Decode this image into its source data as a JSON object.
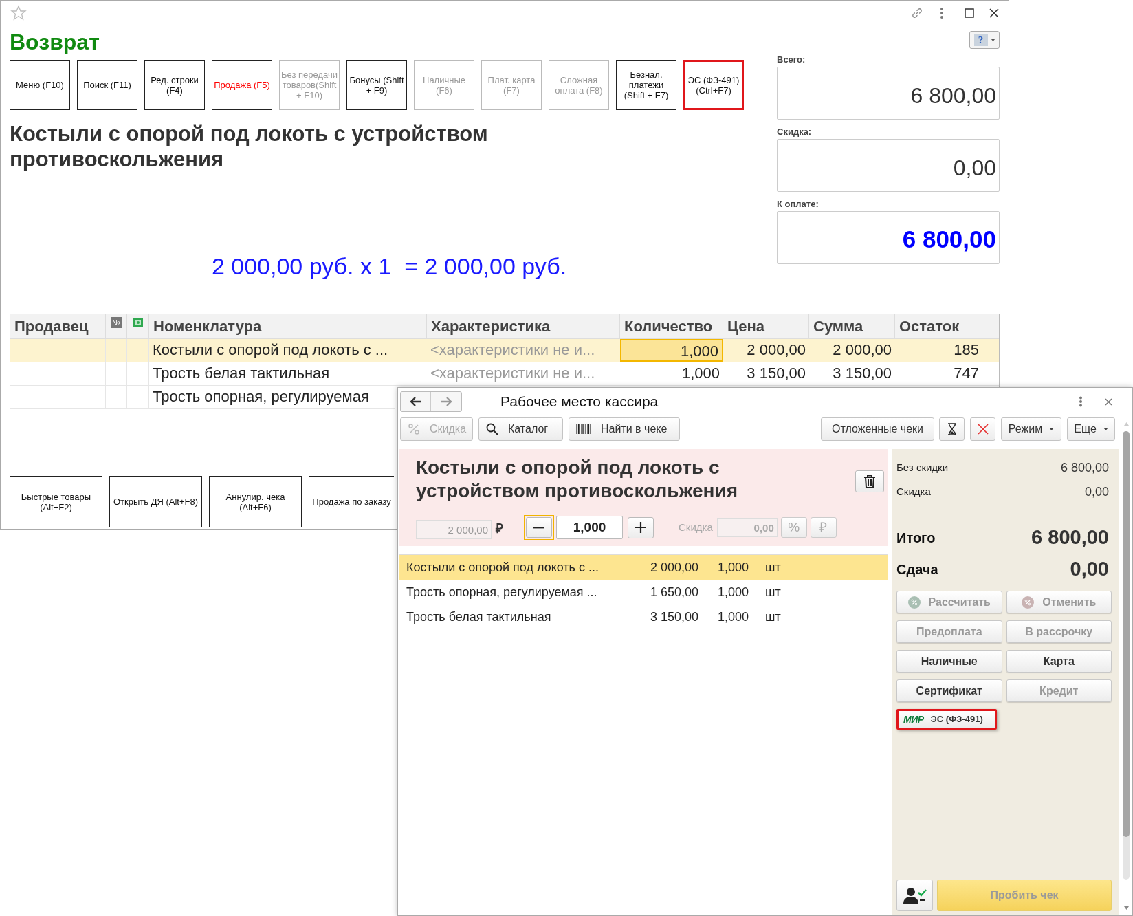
{
  "back_window": {
    "title": "Возврат",
    "help_button": "?",
    "toolbar_buttons": [
      {
        "label": "Меню (F10)",
        "disabled": false,
        "alert": false,
        "highlighted": false
      },
      {
        "label": "Поиск (F11)",
        "disabled": false,
        "alert": false,
        "highlighted": false
      },
      {
        "label": "Ред. строки (F4)",
        "disabled": false,
        "alert": false,
        "highlighted": false
      },
      {
        "label": "Продажа (F5)",
        "disabled": false,
        "alert": true,
        "highlighted": false
      },
      {
        "label": "Без передачи товаров(Shift + F10)",
        "disabled": true,
        "alert": false,
        "highlighted": false
      },
      {
        "label": "Бонусы (Shift + F9)",
        "disabled": false,
        "alert": false,
        "highlighted": false
      },
      {
        "label": "Наличные (F6)",
        "disabled": true,
        "alert": false,
        "highlighted": false
      },
      {
        "label": "Плат. карта (F7)",
        "disabled": true,
        "alert": false,
        "highlighted": false
      },
      {
        "label": "Сложная оплата (F8)",
        "disabled": true,
        "alert": false,
        "highlighted": false
      },
      {
        "label": "Безнал. платежи (Shift + F7)",
        "disabled": false,
        "alert": false,
        "highlighted": false
      },
      {
        "label": "ЭС (ФЗ-491) (Ctrl+F7)",
        "disabled": false,
        "alert": false,
        "highlighted": true
      }
    ],
    "product_title": "Костыли с опорой под локоть с устройством противоскольжения",
    "price_line": "2 000,00 руб. х 1  = 2 000,00 руб.",
    "totals": [
      {
        "label": "Всего:",
        "value": "6 800,00",
        "accent": false
      },
      {
        "label": "Скидка:",
        "value": "0,00",
        "accent": false
      },
      {
        "label": "К оплате:",
        "value": "6 800,00",
        "accent": true
      }
    ],
    "table": {
      "columns": [
        "Продавец",
        "№",
        "Номенклатура",
        "Характеристика",
        "Количество",
        "Цена",
        "Сумма",
        "Остаток"
      ],
      "rows": [
        {
          "name": "Костыли с опорой под локоть с ...",
          "characteristic": "<характеристики не и...",
          "quantity": "1,000",
          "price": "2 000,00",
          "sum": "2 000,00",
          "stock": "185",
          "selected": true
        },
        {
          "name": "Трость белая тактильная",
          "characteristic": "<характеристики не и...",
          "quantity": "1,000",
          "price": "3 150,00",
          "sum": "3 150,00",
          "stock": "747",
          "selected": false
        },
        {
          "name": "Трость опорная, регулируемая",
          "selected": false
        }
      ]
    },
    "bottom_buttons": [
      "Быстрые товары (Alt+F2)",
      "Открыть ДЯ (Alt+F8)",
      "Аннулир. чека (Alt+F6)",
      "Продажа по заказу"
    ]
  },
  "front_window": {
    "title": "Рабочее место кассира",
    "toolbar_left": [
      {
        "label": "Скидка",
        "disabled": true
      },
      {
        "label": "Каталог",
        "disabled": false
      },
      {
        "label": "Найти в чеке",
        "disabled": false
      }
    ],
    "postponed_button": "Отложенные чеки",
    "mode_menu": "Режим",
    "more_menu": "Еще",
    "current_item": {
      "title": "Костыли с опорой под локоть с устройством противоскольжения",
      "price": "2 000,00",
      "currency": "₽",
      "quantity": "1,000",
      "discount_label": "Скидка",
      "discount": "0,00",
      "discount_buttons": [
        "%",
        "₽"
      ]
    },
    "lines": [
      {
        "name": "Костыли с опорой под локоть с ...",
        "price": "2 000,00",
        "quantity": "1,000",
        "unit": "шт",
        "selected": true
      },
      {
        "name": "Трость опорная, регулируемая ...",
        "price": "1 650,00",
        "quantity": "1,000",
        "unit": "шт",
        "selected": false
      },
      {
        "name": "Трость белая тактильная",
        "price": "3 150,00",
        "quantity": "1,000",
        "unit": "шт",
        "selected": false
      }
    ],
    "summary": [
      {
        "label": "Без скидки",
        "value": "6 800,00",
        "bold": false
      },
      {
        "label": "Скидка",
        "value": "0,00",
        "bold": false
      },
      {
        "label": "Итого",
        "value": "6 800,00",
        "bold": true
      },
      {
        "label": "Сдача",
        "value": "0,00",
        "bold": true
      }
    ],
    "payment_buttons": [
      {
        "label": "Рассчитать",
        "disabled": true
      },
      {
        "label": "Отменить",
        "disabled": true
      },
      {
        "label": "Предоплата",
        "disabled": true
      },
      {
        "label": "В рассрочку",
        "disabled": true
      },
      {
        "label": "Наличные",
        "disabled": false
      },
      {
        "label": "Карта",
        "disabled": false
      },
      {
        "label": "Сертификат",
        "disabled": false
      },
      {
        "label": "Кредит",
        "disabled": true
      }
    ],
    "es_button": {
      "logo": "МИР",
      "label": "ЭС (ФЗ-491)",
      "highlighted": true
    },
    "print_button": {
      "label": "Пробить чек",
      "disabled": true
    }
  }
}
